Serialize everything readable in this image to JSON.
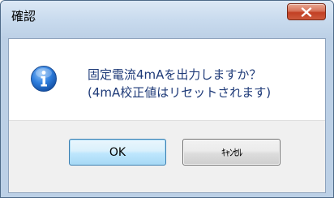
{
  "window": {
    "title": "確認",
    "close_label": "x"
  },
  "dialog": {
    "icon": "info-icon",
    "message_line1": "固定電流4mAを出力しますか？",
    "message_line2": "(4mA校正値はリセットされます)"
  },
  "buttons": {
    "ok_label": "OK",
    "cancel_label": "ｷｬﾝｾﾙ"
  },
  "colors": {
    "message_text": "#1e3a78",
    "icon_blue": "#1f6fd0",
    "close_red": "#c24024"
  }
}
